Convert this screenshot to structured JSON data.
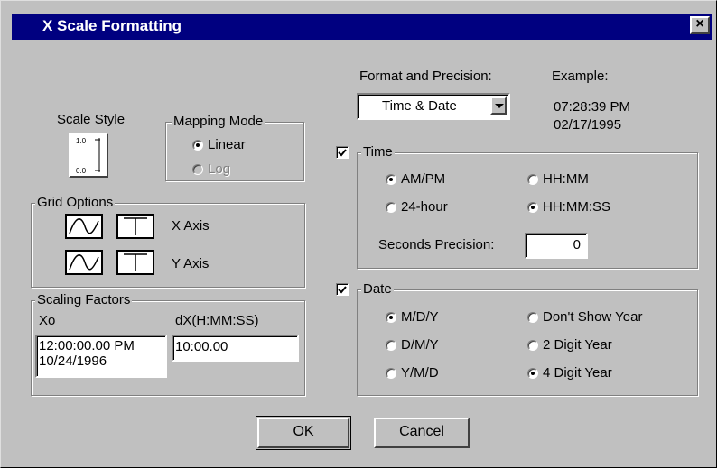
{
  "window": {
    "title": "X Scale Formatting",
    "close_glyph": "×"
  },
  "scale_style": {
    "label": "Scale Style",
    "top_tick": "1.0",
    "bottom_tick": "0.0"
  },
  "mapping_mode": {
    "label": "Mapping Mode",
    "options": [
      "Linear",
      "Log"
    ],
    "selected": "Linear",
    "disabled": [
      "Log"
    ]
  },
  "grid_options": {
    "label": "Grid Options",
    "rows": [
      {
        "label": "X Axis"
      },
      {
        "label": "Y Axis"
      }
    ]
  },
  "scaling_factors": {
    "label": "Scaling Factors",
    "xo_label": "Xo",
    "xo_value_line1": "12:00:00.00 PM",
    "xo_value_line2": "10/24/1996",
    "dx_label": "dX(H:MM:SS)",
    "dx_value": "10:00.00"
  },
  "format": {
    "label": "Format and Precision:",
    "selected": "Time & Date",
    "example_label": "Example:",
    "example_line1": "07:28:39 PM",
    "example_line2": "02/17/1995"
  },
  "time": {
    "label": "Time",
    "checked": true,
    "options": [
      "AM/PM",
      "HH:MM",
      "24-hour",
      "HH:MM:SS"
    ],
    "selected": [
      "AM/PM",
      "HH:MM:SS"
    ],
    "seconds_precision_label": "Seconds Precision:",
    "seconds_precision_value": "0"
  },
  "date": {
    "label": "Date",
    "checked": true,
    "options": [
      "M/D/Y",
      "Don't Show Year",
      "D/M/Y",
      "2 Digit Year",
      "Y/M/D",
      "4 Digit Year"
    ],
    "selected": [
      "M/D/Y",
      "4 Digit Year"
    ]
  },
  "buttons": {
    "ok": "OK",
    "cancel": "Cancel"
  },
  "colors": {
    "title_bar": "#000080",
    "face": "#c0c0c0"
  }
}
